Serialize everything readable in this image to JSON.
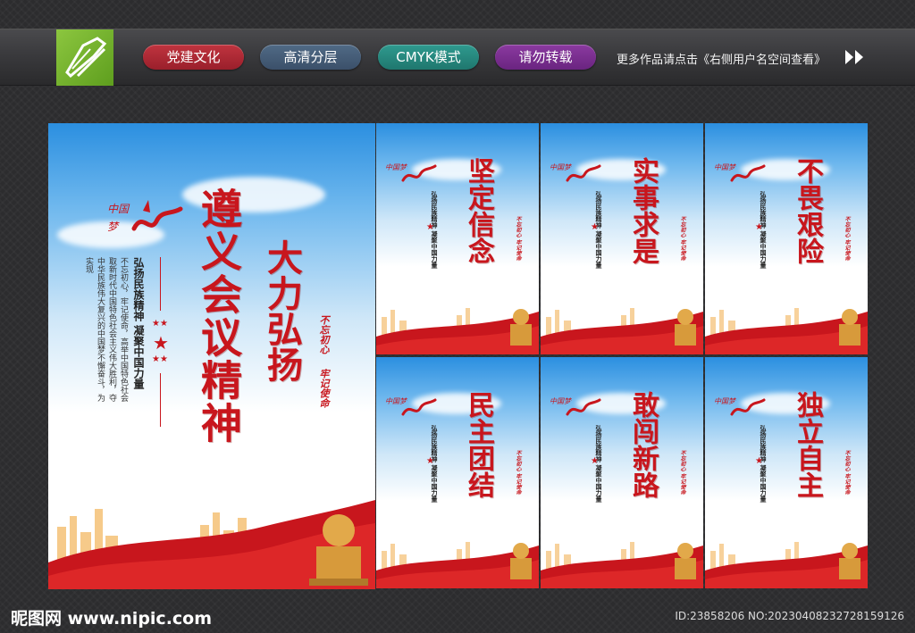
{
  "header": {
    "tags": [
      "党建文化",
      "高清分层",
      "CMYK模式",
      "请勿转载"
    ],
    "more_text": "更多作品请点击《右侧用户名空间查看》"
  },
  "main_poster": {
    "title": "遵义会议精神",
    "slogan": "大力弘扬",
    "subtitle": "弘扬民族精神 凝聚中国力量",
    "body_lines": [
      "不忘初心，牢记使命，高举中国特色社会",
      "取新时代中国特色社会主义伟大胜利，夺",
      "中华民族伟大复兴的中国梦不懈奋斗，为实现"
    ],
    "seal_left": "不忘初心",
    "seal_right": "牢记使命"
  },
  "small_posters": [
    {
      "title": "坚定信念"
    },
    {
      "title": "实事求是"
    },
    {
      "title": "不畏艰险"
    },
    {
      "title": "民主团结"
    },
    {
      "title": "敢闯新路"
    },
    {
      "title": "独立自主"
    }
  ],
  "small_subtitle": "弘扬民族精神 凝聚中国力量",
  "small_seal": "不忘初心 牢记使命",
  "footer": {
    "site": "昵图网 www.nipic.com",
    "id": "ID:23858206 NO:20230408232728159126"
  },
  "colors": {
    "accent_red": "#c8161d",
    "logo_green": "#8cc63f"
  }
}
